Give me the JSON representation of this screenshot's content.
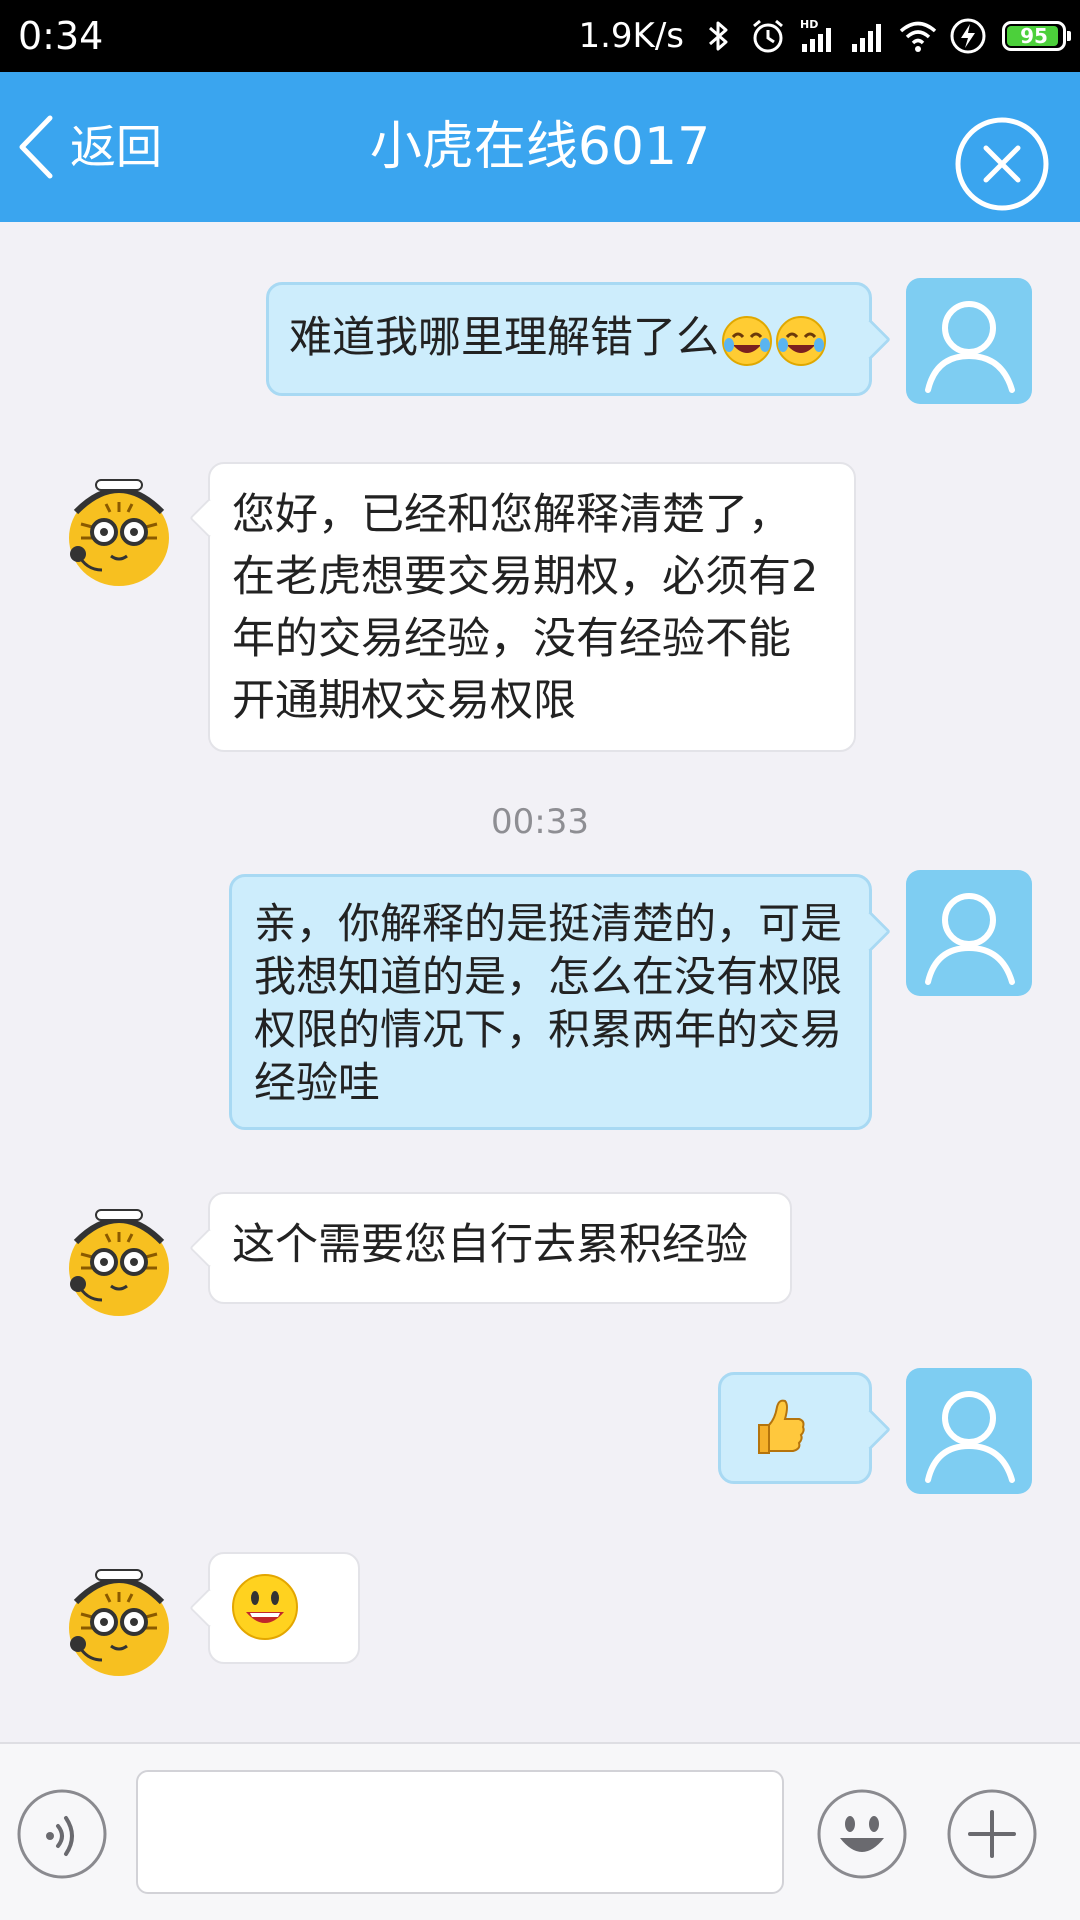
{
  "status_bar": {
    "time": "0:34",
    "network_speed": "1.9K/s",
    "battery_level": 95,
    "battery_text": "95",
    "icons": [
      "bluetooth-icon",
      "alarm-icon",
      "hd-signal-icon",
      "cell-signal-icon",
      "wifi-icon",
      "charging-icon",
      "battery-icon"
    ],
    "battery_color": "#4cd03b"
  },
  "header": {
    "back_label": "返回",
    "title": "小虎在线6017",
    "close_icon": "close-circle-icon",
    "background_color": "#3aa5ef"
  },
  "chat": {
    "messages": [
      {
        "sender": "user",
        "text": "难道我哪里理解错了么",
        "emojis": [
          "tears-of-joy-emoji",
          "tears-of-joy-emoji"
        ]
      },
      {
        "sender": "agent",
        "text": "您好，已经和您解释清楚了，在老虎想要交易期权，必须有2年的交易经验，没有经验不能开通期权交易权限"
      },
      {
        "sender": "user",
        "text": "亲，你解释的是挺清楚的，可是我想知道的是，怎么在没有权限权限的情况下，积累两年的交易经验哇"
      },
      {
        "sender": "agent",
        "text": "这个需要您自行去累积经验"
      },
      {
        "sender": "user",
        "text": "",
        "emojis": [
          "thumbs-up-emoji"
        ]
      },
      {
        "sender": "agent",
        "text": "",
        "emojis": [
          "smiley-face-emoji"
        ]
      }
    ],
    "timestamp": "00:33",
    "user_bubble_color": "#cdedfc",
    "agent_bubble_color": "#ffffff"
  },
  "input_bar": {
    "voice_icon": "voice-icon",
    "message_value": "",
    "emoji_icon": "emoji-face-icon",
    "plus_icon": "plus-icon"
  }
}
